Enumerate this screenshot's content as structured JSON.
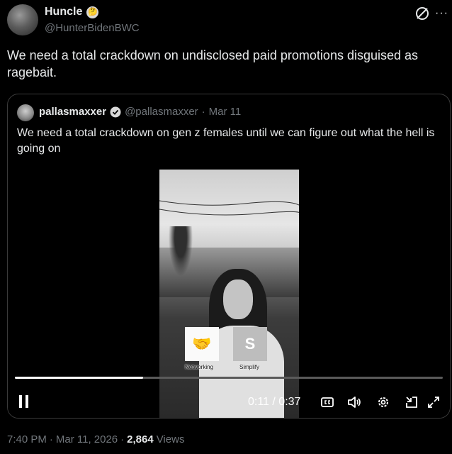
{
  "author": {
    "name": "Huncle",
    "handle": "@HunterBidenBWC",
    "badge": "thinking-face-emoji"
  },
  "post": {
    "text": "We need a total crackdown on undisclosed paid promotions disguised as ragebait."
  },
  "quoted": {
    "name": "pallasmaxxer",
    "handle": "@pallasmaxxer",
    "separator": "·",
    "date": "Mar 11",
    "text": "We need a total crackdown on gen z females until we can figure out what the hell is going on",
    "video": {
      "card_1_label": "Networking",
      "card_2_label": "Simplify",
      "time": "0:11 / 0:37",
      "progress": 0.3
    }
  },
  "footer": {
    "time": "7:40 PM",
    "separator_1": "·",
    "date": "Mar 11, 2026",
    "separator_2": "·",
    "views_count": "2,864",
    "views_label": "Views"
  },
  "colors": {
    "background": "#000000",
    "text_primary": "#e7e9ea",
    "text_secondary": "#71767b",
    "border": "#3a3a3a"
  }
}
